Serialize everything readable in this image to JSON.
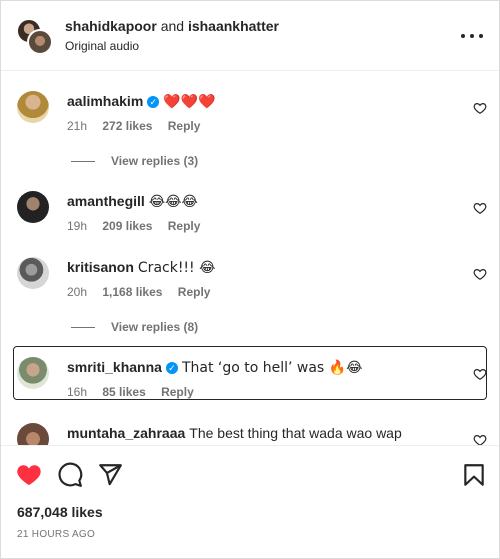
{
  "header": {
    "user1": "shahidkapoor",
    "and_text": "and",
    "user2": "ishaankhatter",
    "audio": "Original audio"
  },
  "comments": [
    {
      "username": "aalimhakim",
      "verified": true,
      "text": "❤️❤️❤️",
      "time": "21h",
      "likes": "272 likes",
      "reply": "Reply",
      "view_replies": "View replies (3)"
    },
    {
      "username": "amanthegill",
      "verified": false,
      "text": "😂😂😂",
      "time": "19h",
      "likes": "209 likes",
      "reply": "Reply"
    },
    {
      "username": "kritisanon",
      "verified": false,
      "text": "Crack!!! 😂",
      "time": "20h",
      "likes": "1,168 likes",
      "reply": "Reply",
      "view_replies": "View replies (8)"
    },
    {
      "username": "smriti_khanna",
      "verified": true,
      "text": "That ‘go to hell’ was 🔥😂",
      "time": "16h",
      "likes": "85 likes",
      "reply": "Reply"
    },
    {
      "username": "muntaha_zahraaa",
      "verified": false,
      "text": "The best thing that wada wao wap"
    }
  ],
  "footer": {
    "likes_total": "687,048 likes",
    "time_ago": "21 HOURS AGO"
  },
  "colors": {
    "like_red": "#ff3040",
    "verified_blue": "#0095f6",
    "text_primary": "#262626",
    "text_secondary": "#737373"
  },
  "icons": [
    "more-icon",
    "heart-filled-icon",
    "comment-icon",
    "share-icon",
    "bookmark-icon",
    "heart-outline-icon",
    "verified-icon"
  ]
}
